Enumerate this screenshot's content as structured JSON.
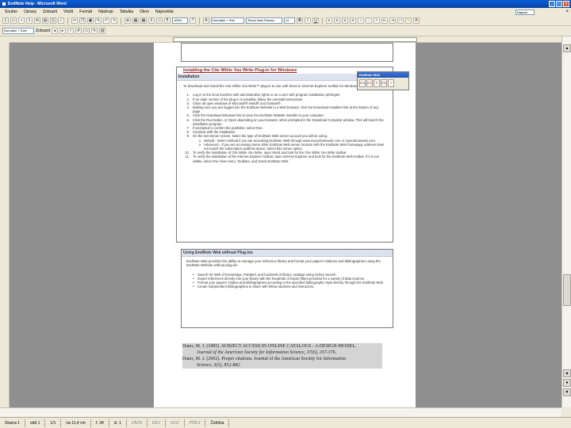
{
  "window": {
    "title": "EndNote Help - Microsoft Word"
  },
  "menu": {
    "items": [
      "Soubor",
      "Úpravy",
      "Zobrazit",
      "Vložit",
      "Formát",
      "Nástroje",
      "Tabulka",
      "Okno",
      "Nápověda"
    ],
    "help_box": "Napsat dotaz"
  },
  "toolbar": {
    "zoom": "100%",
    "style": "Normální + Věe",
    "font": "Times New Roman",
    "size": "12",
    "bold": "B",
    "italic": "I",
    "underline": "U",
    "style2": "Normální + Zobr",
    "track": "Zobrazit"
  },
  "content": {
    "install_heading": "Installing the Cite While You Write Plug-in for Windows",
    "install_section": "Installation",
    "install_intro": "To download and install the Cite While You Write™ plug-in to use with Word or Internet Explorer toolbar for Windows:",
    "steps": [
      {
        "n": "1.",
        "text": "Log in to the local machine with administrative rights or as a user with program installation privileges."
      },
      {
        "n": "2.",
        "text": "If an older version of the plug-in is installed, follow the uninstall instructions."
      },
      {
        "n": "3.",
        "text": "Close all open windows of Microsoft® Word® and Outlook®."
      },
      {
        "n": "4.",
        "text": "Making sure you are logged into the EndNote Website in a Web browser, click the Download Installers link at the bottom of any page."
      },
      {
        "n": "5.",
        "text": "Click the Download Windows link to save the EndNote Website installer to your computer."
      },
      {
        "n": "6.",
        "text": "Click the Run button, or Open depending on your browser, when prompted in the Download Complete window. This will launch the installation program."
      },
      {
        "n": "7.",
        "text": "If prompted to confirm the publisher, select Run."
      },
      {
        "n": "8.",
        "text": "Continue with the installation."
      },
      {
        "n": "9.",
        "text": "On the Set Server screen, select the type of EndNote Web server account you will be using."
      }
    ],
    "sub_steps": [
      {
        "b": "o",
        "text": "Default - Select Default if you are accessing EndNote Web through www.myendnoteweb.com or myendnoteweb.com."
      },
      {
        "b": "o",
        "text": "Advanced - If you are accessing some other EndNote Web server location with the EndNote Web homepage address does not match the subscription address above, select this server option."
      }
    ],
    "steps_tail": [
      {
        "n": "10.",
        "text": "To verify the installation of Cite While You Write, open Word and look for the Cite While You Write toolbar."
      },
      {
        "n": "11.",
        "text": "To verify the installation of the Internet Explorer toolbar, open Internet Explorer and look for the EndNote Web toolbar. If it is not visible, select the View menu, Toolbars, and check EndNote Web."
      }
    ],
    "noplug_section": "Using EndNote Web without Plug-ins",
    "noplug_intro": "EndNote Web provides the ability to manage your reference library and format your paper's citations and bibliographies using the EndNote Website without plug-ins.",
    "bullets": [
      {
        "text": "Search ISI Web of Knowledge, PubMed, and hundreds of library catalogs using Online Search.",
        "link": "Online Search"
      },
      {
        "text": "Import references directly into your library with the hundreds of import filters provided for a variety of data sources.",
        "link": "Import references"
      },
      {
        "text": "Format your papers' citation and bibliographies according to the specified bibliographic style directly through the EndNote Web.",
        "link": "Format your papers' citation and bibliographies"
      },
      {
        "text": "Create independent bibliographies to share with fellow students and instructors.",
        "link": "Create independent bibliographies"
      }
    ]
  },
  "endnote_web_toolbar": {
    "title": "EndNote Web",
    "icons": [
      "EN",
      "EN",
      "F",
      "EN",
      "?"
    ]
  },
  "references": [
    {
      "line1": "Dates, M. J. (1985). SUBJECT ACCESS IN ONLINE CATALOGS - A DESIGN-MODEL.",
      "line2": "Journal of the American Society for Information Science, 37(6), 357-376."
    },
    {
      "line1": "Dates, M. J. (2002). Proper citations. Journal of the American Society for Information",
      "line2": "Science, 3(5), 852-882."
    }
  ],
  "status": {
    "page": "Strana 1",
    "section": "odd 1",
    "pages": "1/1",
    "pos": "na 11,4 cm",
    "line": "ř. 34",
    "col": "sl. 1",
    "rec": "ZÁZN",
    "trk": "REV",
    "ext": "ROZ",
    "ovr": "PŘES",
    "lang": "Čeština"
  }
}
